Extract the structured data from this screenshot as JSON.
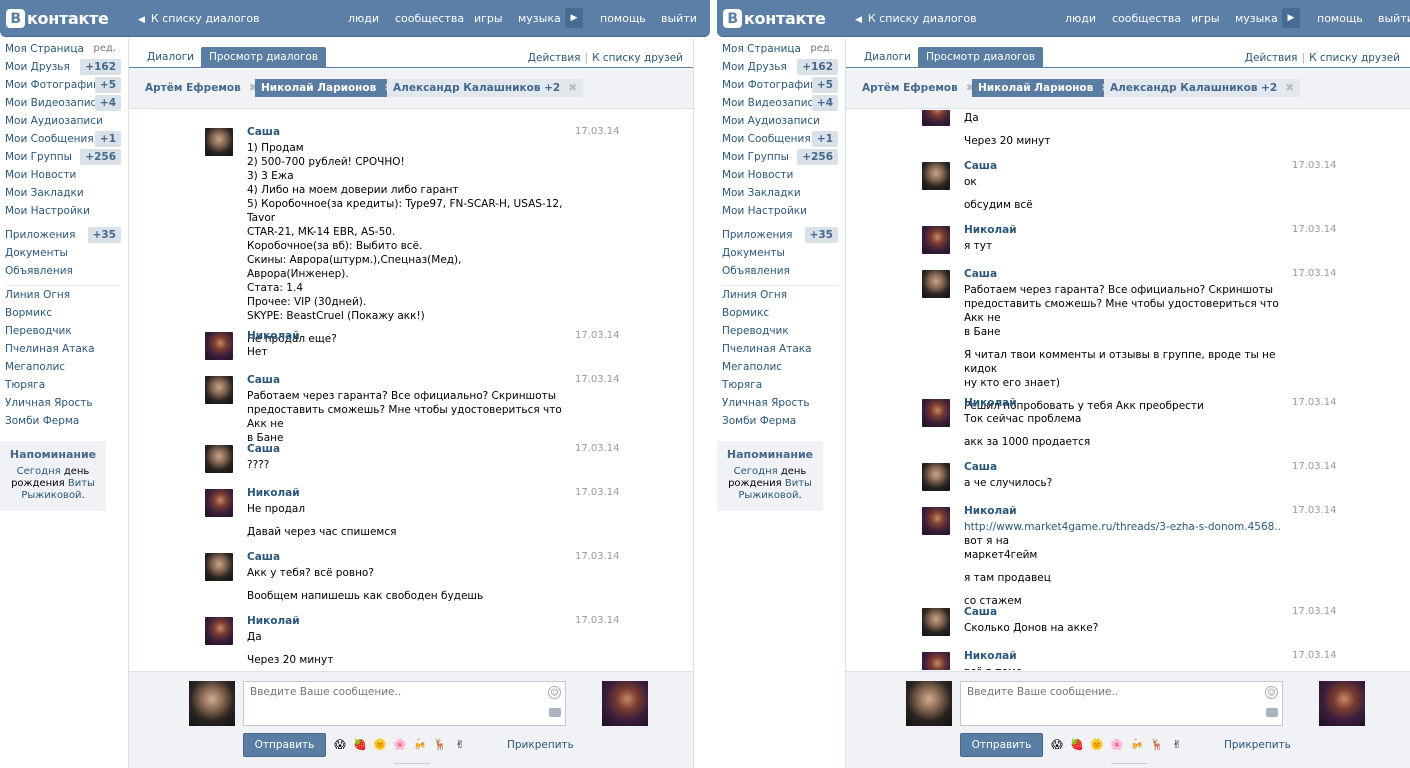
{
  "brand": {
    "letter": "В",
    "name": "контакте"
  },
  "header": {
    "back_label": "К списку диалогов",
    "nav": [
      "люди",
      "сообщества",
      "игры",
      "музыка",
      "помощь",
      "выйти"
    ]
  },
  "sidebar": {
    "edit_label": "ред.",
    "items": [
      {
        "label": "Моя Страница"
      },
      {
        "label": "Мои Друзья",
        "count": "+162"
      },
      {
        "label": "Мои Фотографии",
        "count": "+5"
      },
      {
        "label": "Мои Видеозаписи",
        "count": "+4"
      },
      {
        "label": "Мои Аудиозаписи"
      },
      {
        "label": "Мои Сообщения",
        "count": "+1"
      },
      {
        "label": "Мои Группы",
        "count": "+256"
      },
      {
        "label": "Мои Новости"
      },
      {
        "label": "Мои Закладки"
      },
      {
        "label": "Мои Настройки"
      }
    ],
    "apps": [
      {
        "label": "Приложения",
        "count": "+35"
      },
      {
        "label": "Документы"
      },
      {
        "label": "Объявления"
      }
    ],
    "games": [
      "Линия Огня",
      "Вормикс",
      "Переводчик",
      "Пчелиная Атака",
      "Мегаполис",
      "Тюряга",
      "Уличная Ярость",
      "Зомби Ферма"
    ],
    "reminder": {
      "title": "Напоминание",
      "pre": "Сегодня",
      "mid": "день рождения",
      "name": "Виты Рыжиковой",
      "end": "."
    }
  },
  "tabs": {
    "dialogs": "Диалоги",
    "view": "Просмотр диалогов",
    "actions": "Действия",
    "friends": "К списку друзей"
  },
  "peers": [
    {
      "name": "Артём Ефремов"
    },
    {
      "name": "Николай Ларионов"
    },
    {
      "name": "Александр Калашников +2"
    }
  ],
  "history_left": [
    {
      "from": "Саша",
      "date": "17.03.14",
      "avatar": "sasha",
      "lines": [
        "1) Продам",
        "2) 500-700 рублей! СРОЧНО!",
        "3) 3 Ежа",
        "4) Либо на моем доверии либо гарант",
        "5) Коробочное(за кредиты): Type97, FN-SCAR-H, USAS-12, Tavor",
        "CTAR-21, MK-14 EBR, AS-50.",
        "Коробочное(за вб): Выбито всё.",
        "Скины: Аврора(штурм.),Спецназ(Мед), Аврора(Инженер).",
        "Стата: 1.4",
        "Прочее: VIP (30дней).",
        "SKYPE: BeastCruel (Покажу акк!)",
        "",
        "Не продал еще?"
      ]
    },
    {
      "from": "Николай",
      "date": "17.03.14",
      "avatar": "nik",
      "lines": [
        "Нет"
      ]
    },
    {
      "from": "Саша",
      "date": "17.03.14",
      "avatar": "sasha",
      "lines": [
        "Работаем через гаранта? Все официально? Скриншоты",
        "предоставить сможешь? Мне чтобы удостовериться что Акк не",
        "в Бане"
      ]
    },
    {
      "from": "Саша",
      "date": "17.03.14",
      "avatar": "sasha",
      "lines": [
        "????"
      ]
    },
    {
      "from": "Николай",
      "date": "17.03.14",
      "avatar": "nik",
      "lines": [
        "Не продал",
        "",
        "Давай через час спишемся"
      ]
    },
    {
      "from": "Саша",
      "date": "17.03.14",
      "avatar": "sasha",
      "lines": [
        "Акк у тебя? всё ровно?",
        "",
        "Вообщем напишешь как свободен будешь"
      ]
    },
    {
      "from": "Николай",
      "date": "17.03.14",
      "avatar": "nik",
      "lines": [
        "Да",
        "",
        "Через 20 минут"
      ]
    }
  ],
  "history_right": [
    {
      "from": "",
      "date": "",
      "avatar": "nik",
      "lines": [
        "Да",
        "",
        "Через 20 минут"
      ]
    },
    {
      "from": "Саша",
      "date": "17.03.14",
      "avatar": "sasha",
      "lines": [
        "ок",
        "",
        "обсудим всё"
      ]
    },
    {
      "from": "Николай",
      "date": "17.03.14",
      "avatar": "nik",
      "lines": [
        "я тут"
      ]
    },
    {
      "from": "Саша",
      "date": "17.03.14",
      "avatar": "sasha",
      "lines": [
        "Работаем через гаранта? Все официально? Скриншоты",
        "предоставить сможешь? Мне чтобы удостовериться что Акк не",
        "в Бане",
        "",
        "Я читал твои комменты и отзывы в группе, вроде ты не кидок",
        "ну кто его знает)",
        "",
        "Решил попробовать у тебя Акк преобрести"
      ]
    },
    {
      "from": "Николай",
      "date": "17.03.14",
      "avatar": "nik",
      "lines": [
        "Ток сейчас проблема",
        "",
        "акк за 1000 продается"
      ]
    },
    {
      "from": "Саша",
      "date": "17.03.14",
      "avatar": "sasha",
      "lines": [
        "а че случилось?"
      ]
    },
    {
      "from": "Николай",
      "date": "17.03.14",
      "avatar": "nik",
      "link": "http://www.market4game.ru/threads/3-ezha-s-donom.4568..",
      "lines": [
        " вот я на",
        "маркет4гейм",
        "",
        "я там продавец",
        "",
        "со стажем"
      ]
    },
    {
      "from": "Саша",
      "date": "17.03.14",
      "avatar": "sasha",
      "lines": [
        "Сколько Донов на акке?"
      ]
    },
    {
      "from": "Николай",
      "date": "17.03.14",
      "avatar": "nik",
      "lines": [
        "всё в теме"
      ]
    }
  ],
  "compose": {
    "placeholder": "Введите Ваше сообщение..",
    "send_label": "Отправить",
    "attach_label": "Прикрепить",
    "emojis": [
      "😱",
      "🍓",
      "🌞",
      "🌸",
      "🍻",
      "🦌",
      "✌"
    ]
  },
  "colors": {
    "header": "#5b7fa6",
    "accent": "#597da3",
    "link": "#2b587a"
  }
}
